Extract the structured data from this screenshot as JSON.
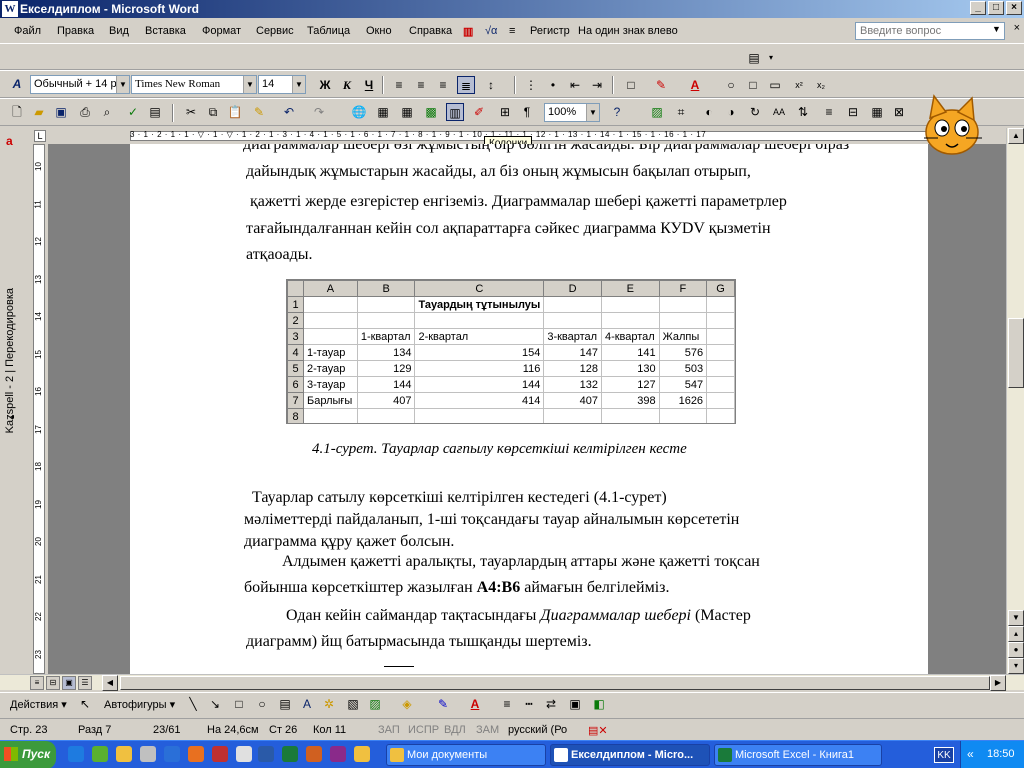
{
  "window": {
    "title": "Екселдиплом - Microsoft Word",
    "min": "_",
    "max": "□",
    "close": "×",
    "app_icon": "W"
  },
  "menu": {
    "items": [
      "Файл",
      "Правка",
      "Вид",
      "Вставка",
      "Формат",
      "Сервис",
      "Таблица",
      "Окно",
      "Справка"
    ],
    "register": "Регистр",
    "hotkey": "На один знак влево",
    "ask_placeholder": "Введите вопрос",
    "doc_close": "×"
  },
  "format_toolbar": {
    "style": "Обычный + 14 р",
    "font": "Times New Roman",
    "size": "14",
    "bold": "Ж",
    "italic": "К",
    "underline": "Ч"
  },
  "standard_toolbar": {
    "zoom": "100%"
  },
  "tooltip": "Колонки",
  "sidebar": {
    "text": "Kazspell - 2 | Перекодировка"
  },
  "document": {
    "line1": "диаграммалар шебері өзі жұмыстың бір бөлігін жасайды. Бір диаграммалар шебері біраз",
    "line2": "дайындық жұмыстарын жасайды, ал біз оның жұмысын бақылап отырып,",
    "line3": "қажетті жерде езгерістер енгіземіз. Диаграммалар шебері қажетті параметрлер",
    "line4": "тағайындалғаннан кейін сол ақпараттарға сәйкес диаграмма КУDV қызметін",
    "line5": "атқаоады.",
    "caption": "4.1-сурет. Тауарлар сағпылу көрсеткіші келтірілген кесте",
    "p2_l1": "Тауарлар    сатылу    көрсеткіші    келтірілген    кестедегі    (4.1-сурет)",
    "p2_l2": "мәліметтерді пайдаланып, 1-ші тоқсандағы тауар айналымын көрсететін",
    "p2_l3": "диаграмма құру қажет болсын.",
    "p3_l1": "Алдымен қажетті аралықты, тауарлардың аттары және қажетті тоқсан",
    "p3_l2a": "бойынша көрсеткіштер жазылған ",
    "p3_l2b": "A4:B6",
    "p3_l2c": " аймағын белгілейміз.",
    "p4_l1a": "Одан кейін саймандар тақтасындағы ",
    "p4_l1b": "Диаграммалар шебері",
    "p4_l1c": " (Мастер",
    "p4_l2": "диаграмм)   йщ   батырмасында тышқанды шертеміз."
  },
  "sheet": {
    "col_headers": [
      "",
      "A",
      "B",
      "C",
      "D",
      "E",
      "F",
      "G"
    ],
    "rows": [
      {
        "n": "1",
        "cells": [
          "",
          "",
          "Тауардың тұтынылуы",
          "",
          "",
          "",
          ""
        ]
      },
      {
        "n": "2",
        "cells": [
          "",
          "",
          "",
          "",
          "",
          "",
          ""
        ]
      },
      {
        "n": "3",
        "cells": [
          "",
          "1-квартал",
          "2-квартал",
          "3-квартал",
          "4-квартал",
          "Жалпы",
          ""
        ]
      },
      {
        "n": "4",
        "cells": [
          "1-тауар",
          "134",
          "154",
          "147",
          "141",
          "576",
          ""
        ]
      },
      {
        "n": "5",
        "cells": [
          "2-тауар",
          "129",
          "116",
          "128",
          "130",
          "503",
          ""
        ]
      },
      {
        "n": "6",
        "cells": [
          "3-тауар",
          "144",
          "144",
          "132",
          "127",
          "547",
          ""
        ]
      },
      {
        "n": "7",
        "cells": [
          "Барлығы",
          "407",
          "414",
          "407",
          "398",
          "1626",
          ""
        ]
      },
      {
        "n": "8",
        "cells": [
          "",
          "",
          "",
          "",
          "",
          "",
          ""
        ]
      }
    ]
  },
  "drawbar": {
    "actions": "Действия ▾",
    "autoshapes": "Автофигуры ▾"
  },
  "status": {
    "page": "Стр.  23",
    "section": "Разд  7",
    "pages": "23/61",
    "at": "На 24,6см",
    "line": "Ст  26",
    "col": "Кол  11",
    "rec": "ЗАП",
    "trk": "ИСПР",
    "ext": "ВДЛ",
    "ovr": "ЗАМ",
    "lang": "русский (Ро"
  },
  "taskbar": {
    "start": "Пуск",
    "tasks": [
      "Мои документы",
      "Екселдиплом - Micro...",
      "Microsoft Excel - Книга1"
    ],
    "lang": "KK",
    "clock": "18:50",
    "collapse": "«"
  },
  "ruler": {
    "numbers": "3 · 1 · 2 · 1 · 1 · ▽ · 1 · ▽ · 1 · 2 · 1 · 3 · 1 · 4 · 1 · 5 · 1 · 6 · 1 · 7 · 1 · 8 · 1 · 9 · 1 · 10 · 1 · 11 · 1 · 12 · 1 · 13 · 1 · 14 · 1 · 15 · 1 · 16 · 1 · 17"
  },
  "vruler": {
    "numbers": [
      "10",
      "11",
      "12",
      "13",
      "14",
      "15",
      "16",
      "17",
      "18",
      "19",
      "20",
      "21",
      "22",
      "23"
    ]
  }
}
